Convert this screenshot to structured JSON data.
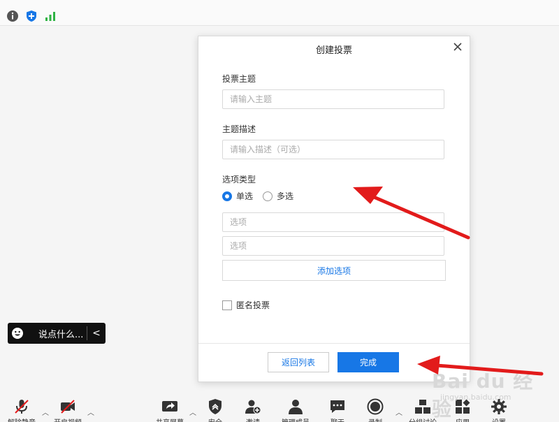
{
  "topbar": {
    "icons": [
      "info-icon",
      "shield-plus-icon",
      "signal-bars-icon"
    ],
    "colors": {
      "info": "#555555",
      "shield": "#1777e6",
      "signal": "#2fb344"
    }
  },
  "chat": {
    "placeholder": "说点什么...",
    "collapse": "<"
  },
  "dialog": {
    "title": "创建投票",
    "close": "✕",
    "topic_label": "投票主题",
    "topic_placeholder": "请输入主题",
    "desc_label": "主题描述",
    "desc_placeholder": "请输入描述（可选）",
    "type_label": "选项类型",
    "radio_single": "单选",
    "radio_multi": "多选",
    "selected": "单选",
    "option_placeholders": [
      "选项",
      "选项"
    ],
    "add_option": "添加选项",
    "anonymous": "匿名投票",
    "anonymous_checked": false,
    "back_button": "返回列表",
    "done_button": "完成"
  },
  "toolbar": {
    "items": [
      {
        "name": "mic",
        "label": "解除静音"
      },
      {
        "name": "video",
        "label": "开启视频"
      },
      {
        "name": "share",
        "label": "共享屏幕"
      },
      {
        "name": "security",
        "label": "安全"
      },
      {
        "name": "invite",
        "label": "邀请"
      },
      {
        "name": "members",
        "label": "管理成员"
      },
      {
        "name": "chat",
        "label": "聊天"
      },
      {
        "name": "record",
        "label": "录制"
      },
      {
        "name": "breakout",
        "label": "分组讨论"
      },
      {
        "name": "apps",
        "label": "应用"
      },
      {
        "name": "settings",
        "label": "设置"
      }
    ]
  },
  "watermark": {
    "main": "Bai du 经验",
    "sub": "jingyan.baidu.com"
  },
  "colors": {
    "accent": "#1777e6",
    "arrow": "#e21b1b",
    "chat_bg": "#111111"
  }
}
